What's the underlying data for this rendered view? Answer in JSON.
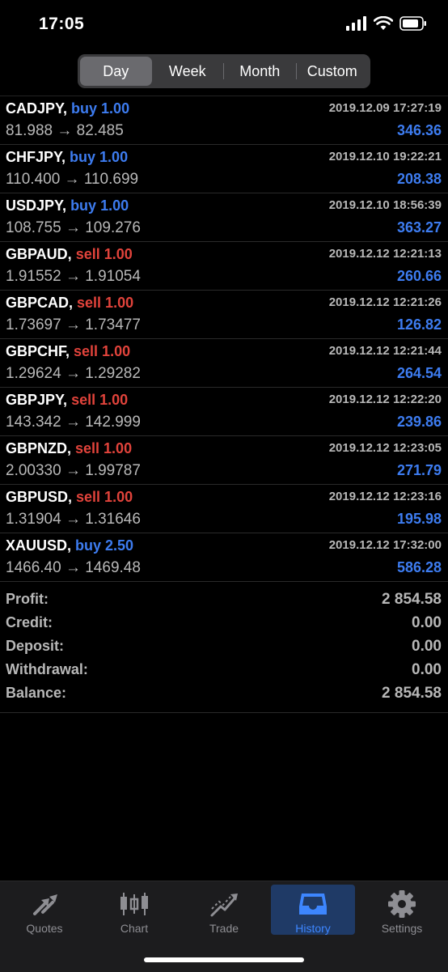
{
  "status_bar": {
    "time": "17:05"
  },
  "period_tabs": [
    {
      "label": "Day",
      "active": true
    },
    {
      "label": "Week",
      "active": false
    },
    {
      "label": "Month",
      "active": false
    },
    {
      "label": "Custom",
      "active": false
    }
  ],
  "deals": [
    {
      "symbol": "CADJPY,",
      "side": "buy 1.00",
      "type": "buy",
      "time": "2019.12.09 17:27:19",
      "prices": "81.988 → 82.485",
      "profit": "346.36"
    },
    {
      "symbol": "CHFJPY,",
      "side": "buy 1.00",
      "type": "buy",
      "time": "2019.12.10 19:22:21",
      "prices": "110.400 → 110.699",
      "profit": "208.38"
    },
    {
      "symbol": "USDJPY,",
      "side": "buy 1.00",
      "type": "buy",
      "time": "2019.12.10 18:56:39",
      "prices": "108.755 → 109.276",
      "profit": "363.27"
    },
    {
      "symbol": "GBPAUD,",
      "side": "sell 1.00",
      "type": "sell",
      "time": "2019.12.12 12:21:13",
      "prices": "1.91552 → 1.91054",
      "profit": "260.66"
    },
    {
      "symbol": "GBPCAD,",
      "side": "sell 1.00",
      "type": "sell",
      "time": "2019.12.12 12:21:26",
      "prices": "1.73697 → 1.73477",
      "profit": "126.82"
    },
    {
      "symbol": "GBPCHF,",
      "side": "sell 1.00",
      "type": "sell",
      "time": "2019.12.12 12:21:44",
      "prices": "1.29624 → 1.29282",
      "profit": "264.54"
    },
    {
      "symbol": "GBPJPY,",
      "side": "sell 1.00",
      "type": "sell",
      "time": "2019.12.12 12:22:20",
      "prices": "143.342 → 142.999",
      "profit": "239.86"
    },
    {
      "symbol": "GBPNZD,",
      "side": "sell 1.00",
      "type": "sell",
      "time": "2019.12.12 12:23:05",
      "prices": "2.00330 → 1.99787",
      "profit": "271.79"
    },
    {
      "symbol": "GBPUSD,",
      "side": "sell 1.00",
      "type": "sell",
      "time": "2019.12.12 12:23:16",
      "prices": "1.31904 → 1.31646",
      "profit": "195.98"
    },
    {
      "symbol": "XAUUSD,",
      "side": "buy 2.50",
      "type": "buy",
      "time": "2019.12.12 17:32:00",
      "prices": "1466.40 → 1469.48",
      "profit": "586.28"
    }
  ],
  "summary": [
    {
      "label": "Profit:",
      "value": "2 854.58"
    },
    {
      "label": "Credit:",
      "value": "0.00"
    },
    {
      "label": "Deposit:",
      "value": "0.00"
    },
    {
      "label": "Withdrawal:",
      "value": "0.00"
    },
    {
      "label": "Balance:",
      "value": "2 854.58"
    }
  ],
  "tabbar": [
    {
      "label": "Quotes",
      "icon": "quotes-arrows-icon",
      "active": false
    },
    {
      "label": "Chart",
      "icon": "candlestick-icon",
      "active": false
    },
    {
      "label": "Trade",
      "icon": "trend-line-icon",
      "active": false
    },
    {
      "label": "History",
      "icon": "inbox-tray-icon",
      "active": true
    },
    {
      "label": "Settings",
      "icon": "gear-icon",
      "active": false
    }
  ],
  "colors": {
    "buy": "#3d7cf0",
    "sell": "#e1433b",
    "active_tab": "#3d86ff"
  }
}
